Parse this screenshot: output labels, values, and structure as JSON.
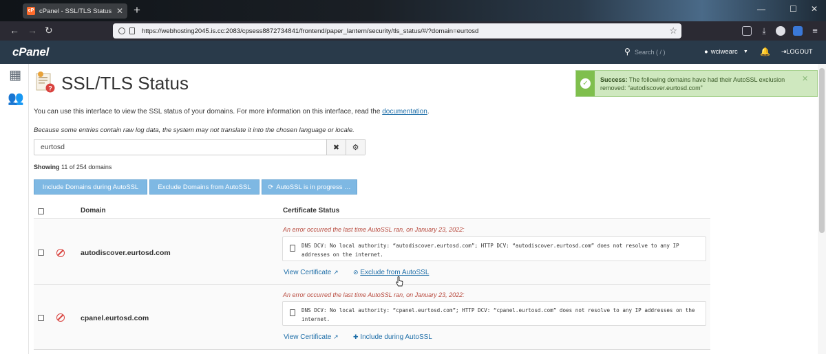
{
  "browser": {
    "tab_title": "cPanel - SSL/TLS Status",
    "url": "https://webhosting2045.is.cc:2083/cpsess8872734841/frontend/paper_lantern/security/tls_status/#/?domain=eurtosd"
  },
  "cpanel": {
    "logo": "cPanel",
    "search_placeholder": "Search ( / )",
    "username": "wciwearc",
    "logout": "LOGOUT"
  },
  "page": {
    "title": "SSL/TLS Status",
    "intro_text": "You can use this interface to view the SSL status of your domains. For more information on this interface, read the ",
    "intro_link": "documentation",
    "intro_end": ".",
    "note": "Because some entries contain raw log data, the system may not translate it into the chosen language or locale.",
    "filter_value": "eurtosd",
    "showing_label": "Showing",
    "showing_count": "11 of 254 domains"
  },
  "actions": {
    "include": "Include Domains during AutoSSL",
    "exclude": "Exclude Domains from AutoSSL",
    "progress": "AutoSSL is in progress …"
  },
  "table": {
    "col_domain": "Domain",
    "col_status": "Certificate Status",
    "rows": [
      {
        "domain": "autodiscover.eurtosd.com",
        "error_title": "An error occurred the last time AutoSSL ran, on January 23, 2022:",
        "error_message": "DNS DCV: No local authority: “autodiscover.eurtosd.com”; HTTP DCV: “autodiscover.eurtosd.com” does not resolve to any IP addresses on the internet.",
        "view_link": "View Certificate",
        "toggle_link": "Exclude from AutoSSL"
      },
      {
        "domain": "cpanel.eurtosd.com",
        "error_title": "An error occurred the last time AutoSSL ran, on January 23, 2022:",
        "error_message": "DNS DCV: No local authority: “cpanel.eurtosd.com”; HTTP DCV: “cpanel.eurtosd.com” does not resolve to any IP addresses on the internet.",
        "view_link": "View Certificate",
        "toggle_link": "Include during AutoSSL"
      }
    ]
  },
  "alert": {
    "title": "Success:",
    "message": "The following domains have had their AutoSSL exclusion removed: “autodiscover.eurtosd.com”"
  },
  "colors": {
    "header_bg": "#293a4a",
    "action_button": "#7eb8e3",
    "error_red": "#d9423e",
    "link_blue": "#1e6ea8",
    "success_bg": "#cfe8bf"
  }
}
